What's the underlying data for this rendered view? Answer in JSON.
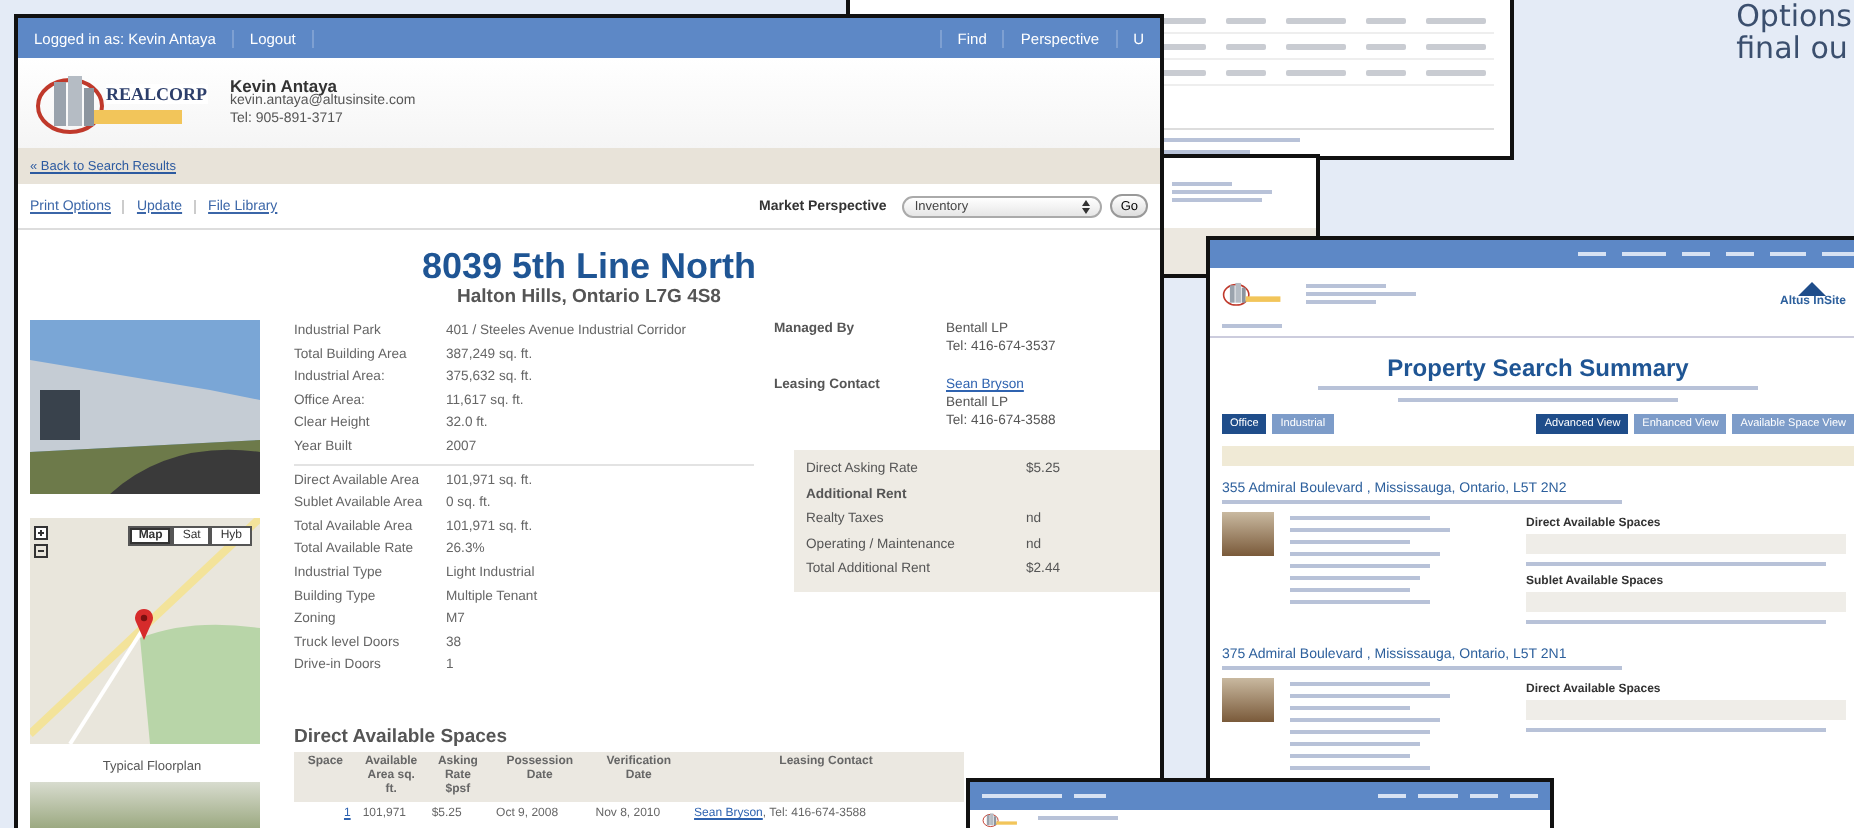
{
  "slide_text": [
    "Options",
    "final ou"
  ],
  "main_window": {
    "nav": {
      "user": "Logged in as: Kevin Antaya",
      "left_links": [
        "Logout"
      ],
      "right_links": [
        "Find",
        "Perspective",
        "U"
      ]
    },
    "header": {
      "logo": "REALCORP",
      "name": "Kevin Antaya",
      "email": "kevin.antaya@altusinsite.com",
      "phone": "Tel: 905-891-3717"
    },
    "back_link": "« Back to Search Results",
    "actions": [
      "Print Options",
      "Update",
      "File Library"
    ],
    "market_perspective": {
      "label": "Market Perspective",
      "value": "Inventory",
      "button": "Go"
    },
    "title": "8039 5th Line North",
    "subtitle": "Halton Hills, Ontario L7G 4S8",
    "map_modes": [
      {
        "label": "Map",
        "selected": true
      },
      {
        "label": "Sat",
        "selected": false
      },
      {
        "label": "Hyb",
        "selected": false
      }
    ],
    "floorplan_caption": "Typical Floorplan",
    "detail_groups": [
      [
        {
          "label": "Industrial Park",
          "value": "401 / Steeles Avenue Industrial Corridor"
        },
        {
          "label": "Total Building Area",
          "value": "387,249 sq. ft."
        },
        {
          "label": "Industrial Area:",
          "value": "375,632 sq. ft."
        },
        {
          "label": "Office Area:",
          "value": "11,617 sq. ft."
        },
        {
          "label": "Clear Height",
          "value": "32.0 ft."
        },
        {
          "label": "Year Built",
          "value": "2007"
        }
      ],
      [
        {
          "label": "Direct Available Area",
          "value": "101,971 sq. ft."
        },
        {
          "label": "Sublet Available Area",
          "value": "0 sq. ft."
        },
        {
          "label": "Total Available Area",
          "value": "101,971 sq. ft."
        },
        {
          "label": "Total Available Rate",
          "value": "26.3%"
        },
        {
          "label": "Industrial Type",
          "value": "Light Industrial"
        },
        {
          "label": "Building Type",
          "value": "Multiple Tenant"
        },
        {
          "label": "Zoning",
          "value": "M7"
        },
        {
          "label": "Truck level Doors",
          "value": "38"
        },
        {
          "label": "Drive-in Doors",
          "value": "1"
        }
      ]
    ],
    "contacts": [
      {
        "label": "Managed By",
        "lines": [
          {
            "text": "Bentall LP",
            "kind": "plain"
          },
          {
            "text": "Tel: 416-674-3537",
            "kind": "plain"
          }
        ]
      },
      {
        "label": "Leasing Contact",
        "lines": [
          {
            "text": "Sean Bryson",
            "kind": "link"
          },
          {
            "text": "Bentall LP",
            "kind": "plain"
          },
          {
            "text": "Tel: 416-674-3588",
            "kind": "plain"
          }
        ]
      }
    ],
    "rates": [
      {
        "kind": "row",
        "label": "Direct Asking Rate",
        "value": "$5.25"
      },
      {
        "kind": "heading",
        "label": "Additional Rent"
      },
      {
        "kind": "row",
        "label": "Realty Taxes",
        "value": "nd"
      },
      {
        "kind": "row",
        "label": "Operating / Maintenance",
        "value": "nd"
      },
      {
        "kind": "row",
        "label": "Total Additional Rent",
        "value": "$2.44"
      }
    ],
    "spaces": {
      "title": "Direct Available Spaces",
      "columns": [
        "Space",
        "Available Area sq. ft.",
        "Asking Rate $psf",
        "Possession Date",
        "Verification Date",
        "Leasing Contact"
      ],
      "rows": [
        {
          "space": "1",
          "area": "101,971",
          "rate": "$5.25",
          "possession": "Oct 9, 2008",
          "verification": "Nov 8, 2010",
          "contact_name": "Sean Bryson",
          "contact_phone": ", Tel: 416-674-3588"
        }
      ]
    }
  },
  "property_window": {
    "logo": "Altus InSite",
    "title": "Property Search Summary",
    "tabs": [
      {
        "label": "Office",
        "selected": true
      },
      {
        "label": "Industrial",
        "selected": false
      }
    ],
    "views": [
      {
        "label": "Advanced View",
        "selected": true
      },
      {
        "label": "Enhanced View",
        "selected": false
      },
      {
        "label": "Available Space View",
        "selected": false
      }
    ],
    "listings": [
      {
        "address": "355 Admiral Boulevard , Mississauga, Ontario, L5T 2N2",
        "sections": [
          "Direct Available Spaces",
          "Sublet Available Spaces"
        ]
      },
      {
        "address": "375 Admiral Boulevard , Mississauga, Ontario, L5T 2N1",
        "sections": [
          "Direct Available Spaces"
        ]
      }
    ]
  }
}
